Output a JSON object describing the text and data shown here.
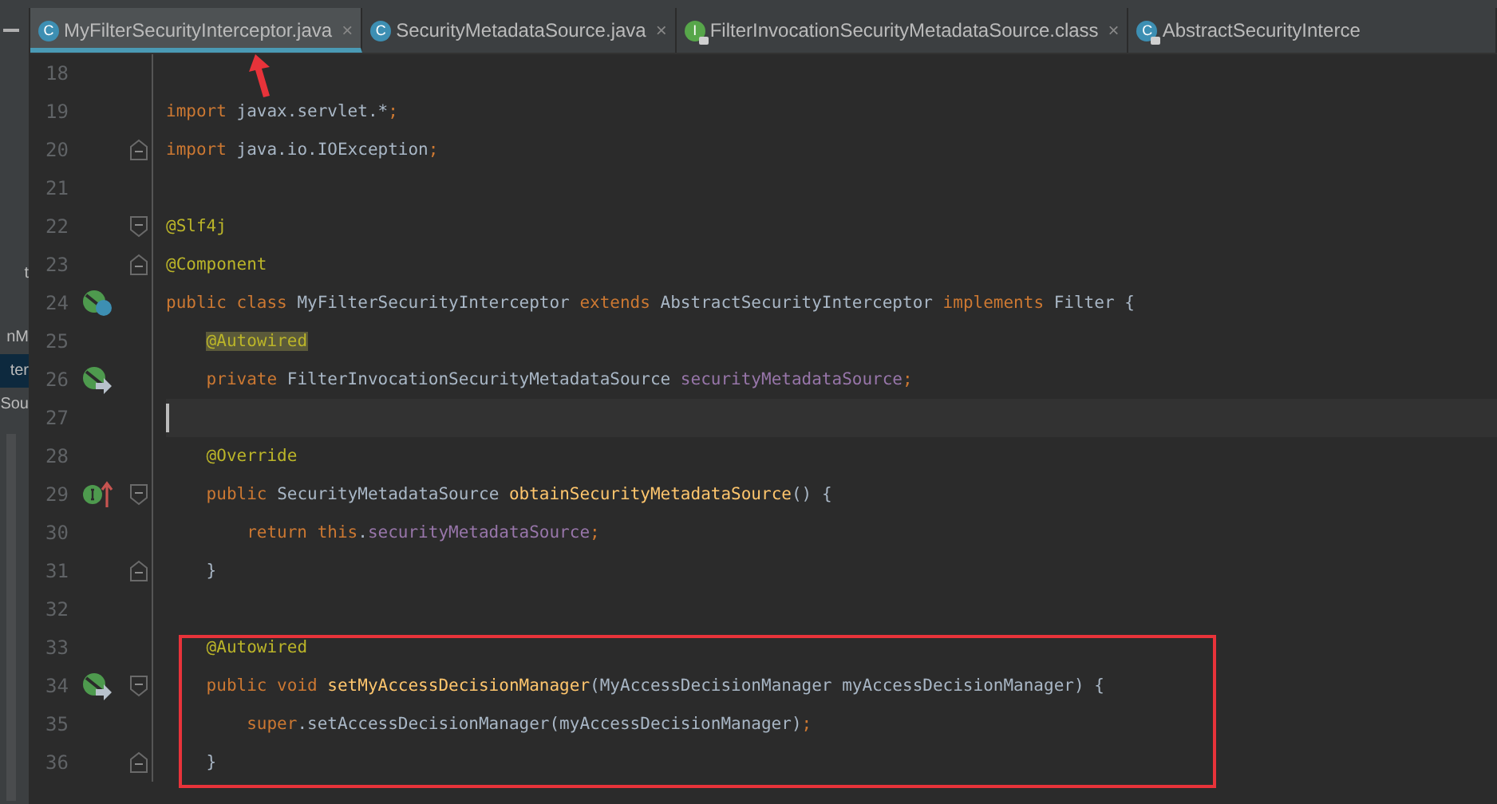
{
  "sidebar": {
    "items": [
      {
        "label": "t",
        "selected": false
      },
      {
        "label": "nM",
        "selected": false
      },
      {
        "label": "ter",
        "selected": true
      },
      {
        "label": "Sou",
        "selected": false
      }
    ]
  },
  "tabs": [
    {
      "label": "MyFilterSecurityInterceptor.java",
      "icon": {
        "kind": "class",
        "letter": "C",
        "locked": false
      },
      "close": "×",
      "selected": true
    },
    {
      "label": "SecurityMetadataSource.java",
      "icon": {
        "kind": "class",
        "letter": "C",
        "locked": false
      },
      "close": "×",
      "selected": false
    },
    {
      "label": "FilterInvocationSecurityMetadataSource.class",
      "icon": {
        "kind": "interface",
        "letter": "I",
        "locked": true
      },
      "close": "×",
      "selected": false
    },
    {
      "label": "AbstractSecurityInterce",
      "icon": {
        "kind": "class",
        "letter": "C",
        "locked": true
      },
      "selected": false
    }
  ],
  "lines": [
    {
      "number": "18"
    },
    {
      "number": "19",
      "tokens": [
        {
          "kind": "keyword",
          "t": "import "
        },
        {
          "kind": "plain",
          "t": "javax.servlet.*"
        },
        {
          "kind": "keyword",
          "t": ";"
        }
      ]
    },
    {
      "number": "20",
      "fold": {
        "kind": "end"
      },
      "tokens": [
        {
          "kind": "keyword",
          "t": "import "
        },
        {
          "kind": "plain",
          "t": "java.io.IOException"
        },
        {
          "kind": "keyword",
          "t": ";"
        }
      ]
    },
    {
      "number": "21"
    },
    {
      "number": "22",
      "fold": {
        "kind": "start"
      },
      "tokens": [
        {
          "kind": "annotation",
          "t": "@Slf4j"
        }
      ]
    },
    {
      "number": "23",
      "fold": {
        "kind": "end"
      },
      "tokens": [
        {
          "kind": "annotation",
          "t": "@Component"
        }
      ]
    },
    {
      "number": "24",
      "gutter": {
        "kind": "class-impl"
      },
      "tokens": [
        {
          "kind": "keyword",
          "t": "public class "
        },
        {
          "kind": "plain",
          "t": "MyFilterSecurityInterceptor "
        },
        {
          "kind": "keyword",
          "t": "extends "
        },
        {
          "kind": "plain",
          "t": "AbstractSecurityInterceptor "
        },
        {
          "kind": "keyword",
          "t": "implements "
        },
        {
          "kind": "plain",
          "t": "Filter {"
        }
      ]
    },
    {
      "number": "25",
      "tokens": [
        {
          "kind": "annotation",
          "t": "    @Autowired",
          "highlighted": true
        }
      ]
    },
    {
      "number": "26",
      "gutter": {
        "kind": "injected"
      },
      "tokens": [
        {
          "kind": "keyword",
          "t": "    private "
        },
        {
          "kind": "plain",
          "t": "FilterInvocationSecurityMetadataSource "
        },
        {
          "kind": "field",
          "t": "securityMetadataSource"
        },
        {
          "kind": "keyword",
          "t": ";"
        }
      ]
    },
    {
      "number": "27",
      "current": true
    },
    {
      "number": "28",
      "tokens": [
        {
          "kind": "annotation",
          "t": "    @Override"
        }
      ]
    },
    {
      "number": "29",
      "gutter": {
        "kind": "implements"
      },
      "fold": {
        "kind": "start"
      },
      "tokens": [
        {
          "kind": "keyword",
          "t": "    public "
        },
        {
          "kind": "plain",
          "t": "SecurityMetadataSource "
        },
        {
          "kind": "method",
          "t": "obtainSecurityMetadataSource"
        },
        {
          "kind": "plain",
          "t": "() {"
        }
      ]
    },
    {
      "number": "30",
      "tokens": [
        {
          "kind": "keyword",
          "t": "        return this"
        },
        {
          "kind": "plain",
          "t": "."
        },
        {
          "kind": "field",
          "t": "securityMetadataSource"
        },
        {
          "kind": "keyword",
          "t": ";"
        }
      ]
    },
    {
      "number": "31",
      "fold": {
        "kind": "end"
      },
      "tokens": [
        {
          "kind": "plain",
          "t": "    }"
        }
      ]
    },
    {
      "number": "32"
    },
    {
      "number": "33",
      "tokens": [
        {
          "kind": "annotation",
          "t": "    @Autowired"
        }
      ]
    },
    {
      "number": "34",
      "gutter": {
        "kind": "injected"
      },
      "fold": {
        "kind": "start"
      },
      "tokens": [
        {
          "kind": "keyword",
          "t": "    public void "
        },
        {
          "kind": "method",
          "t": "setMyAccessDecisionManager"
        },
        {
          "kind": "plain",
          "t": "(MyAccessDecisionManager myAccessDecisionManager) {"
        }
      ]
    },
    {
      "number": "35",
      "tokens": [
        {
          "kind": "keyword",
          "t": "        super"
        },
        {
          "kind": "plain",
          "t": ".setAccessDecisionManager(myAccessDecisionManager)"
        },
        {
          "kind": "keyword",
          "t": ";"
        }
      ]
    },
    {
      "number": "36",
      "fold": {
        "kind": "end"
      },
      "tokens": [
        {
          "kind": "plain",
          "t": "    }"
        }
      ]
    }
  ]
}
